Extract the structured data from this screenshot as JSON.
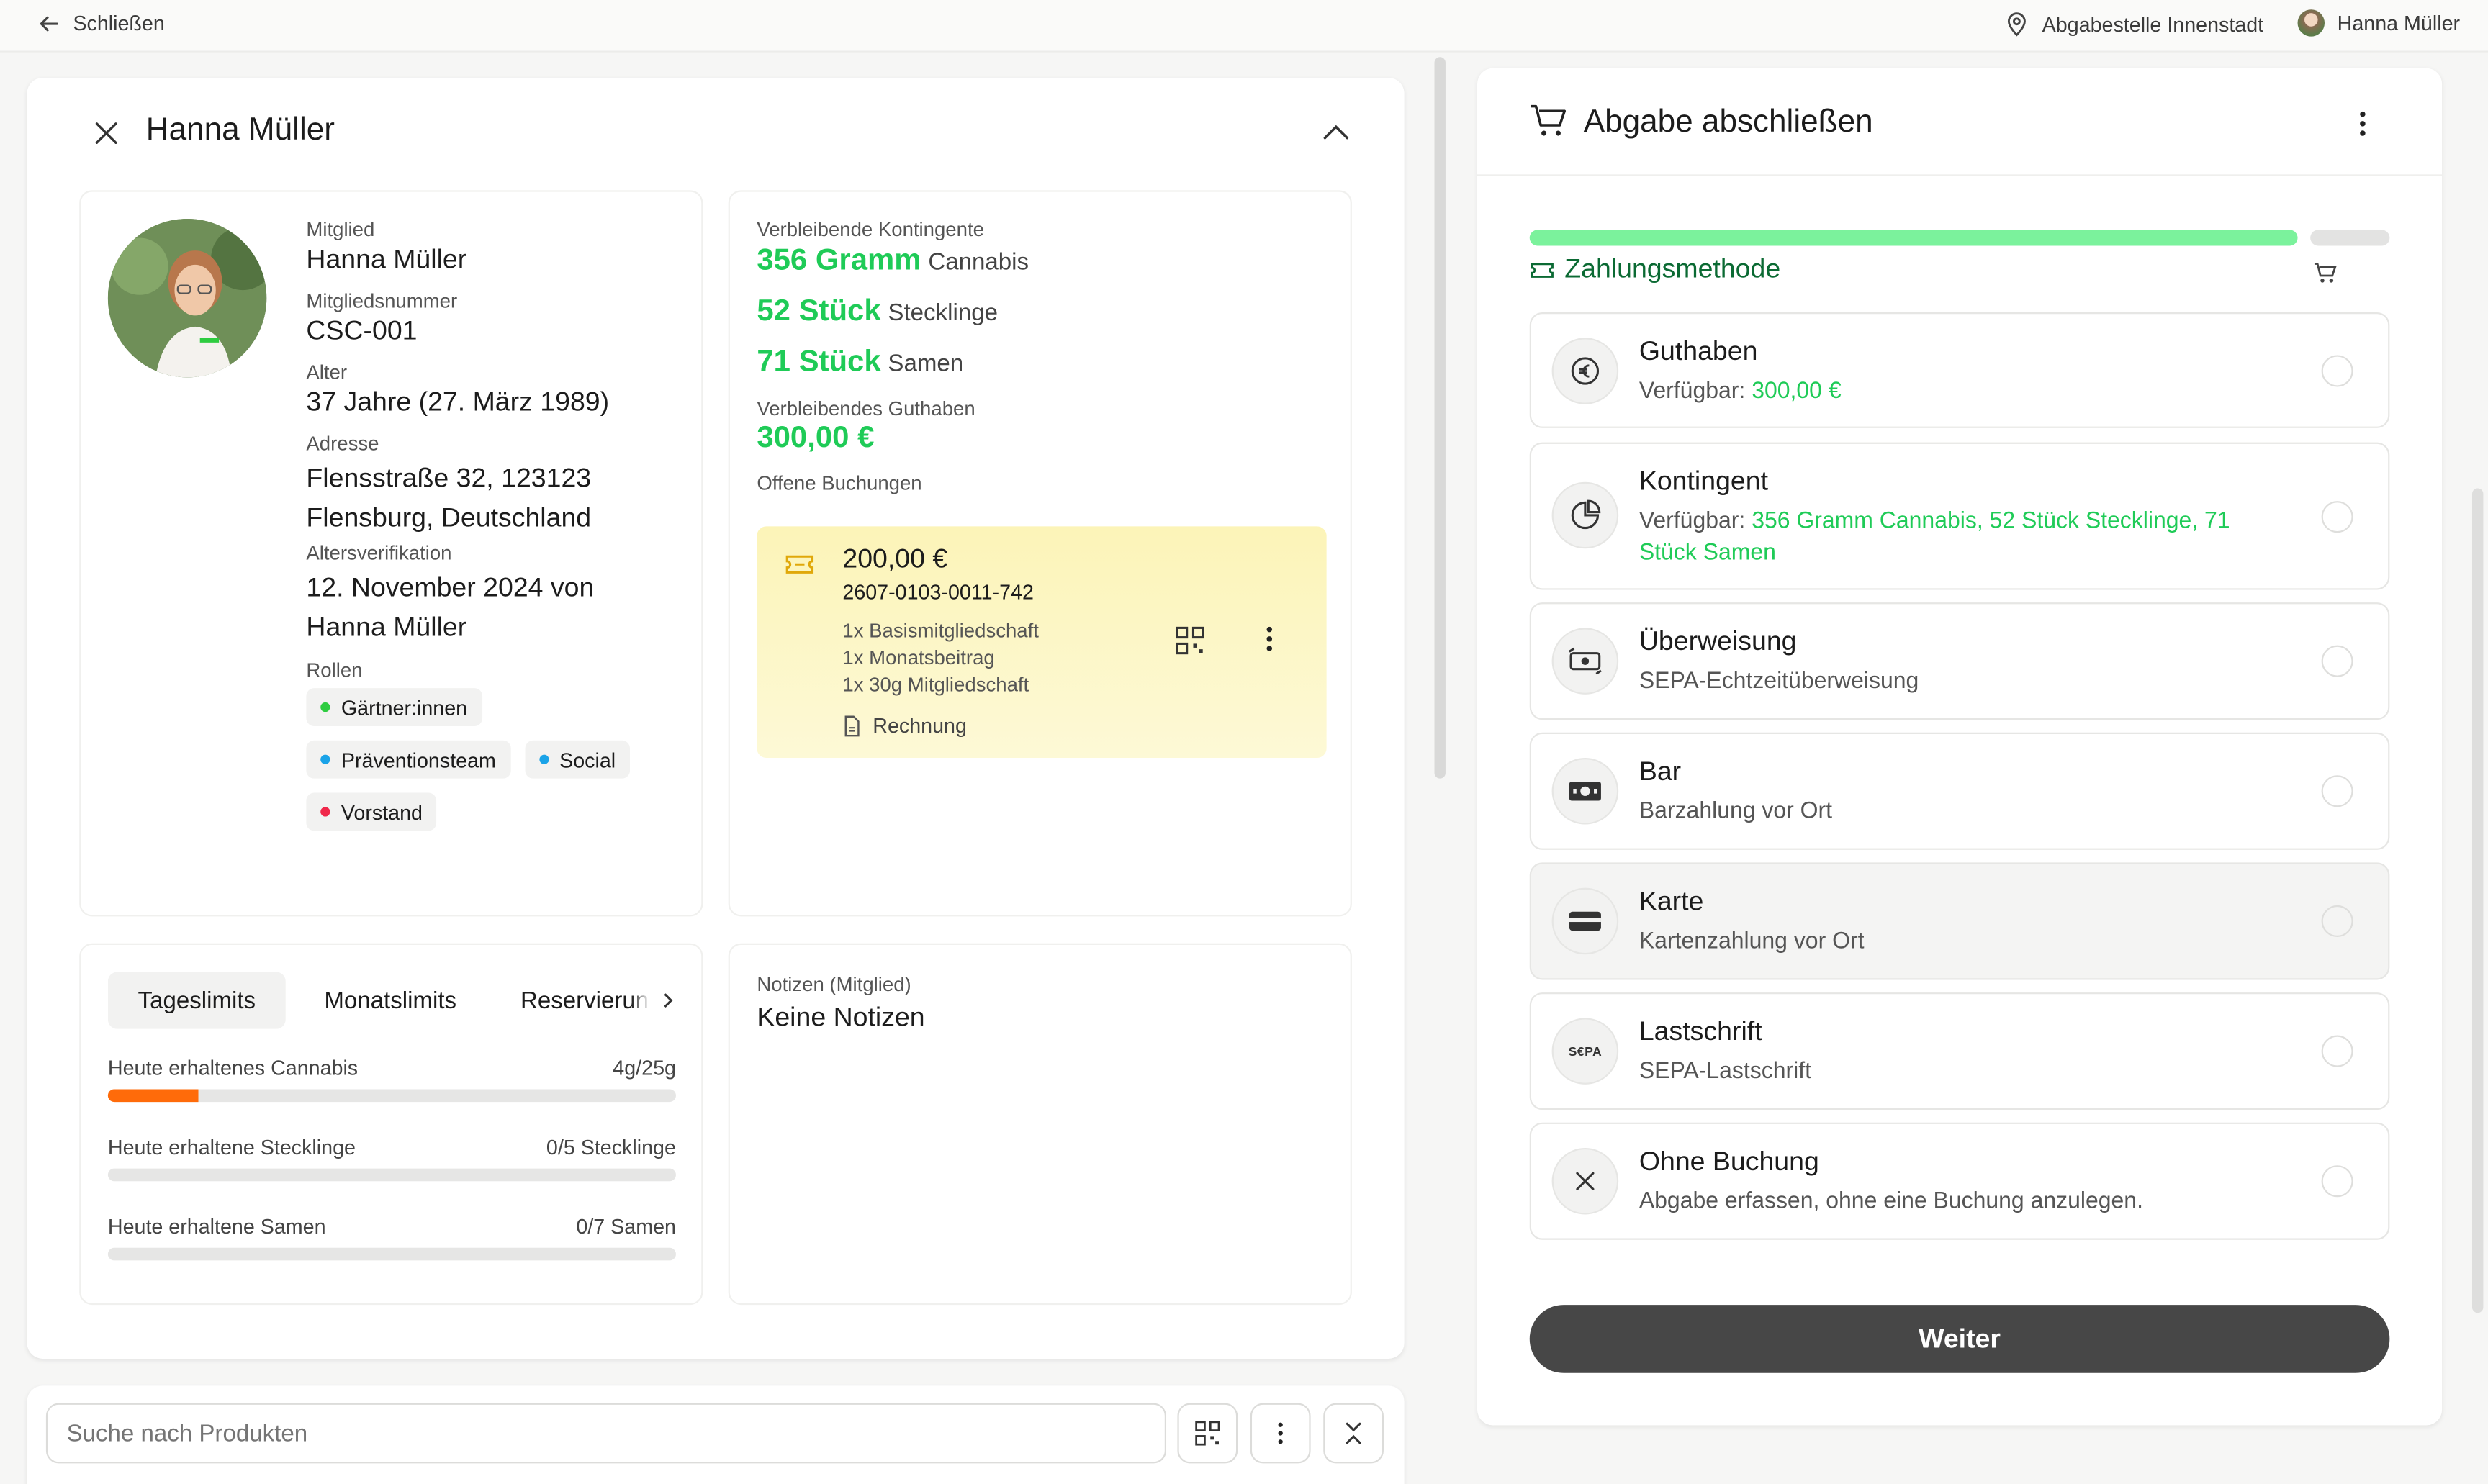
{
  "topbar": {
    "close_label": "Schließen",
    "location": "Abgabestelle Innenstadt",
    "user_name": "Hanna Müller"
  },
  "member_panel": {
    "title": "Hanna Müller",
    "profile": {
      "member_label": "Mitglied",
      "member_value": "Hanna Müller",
      "number_label": "Mitgliedsnummer",
      "number_value": "CSC-001",
      "age_label": "Alter",
      "age_value": "37 Jahre (27. März 1989)",
      "address_label": "Adresse",
      "address_line1": "Flensstraße 32, 123123",
      "address_line2": "Flensburg, Deutschland",
      "verification_label": "Altersverifikation",
      "verification_line1": "12. November 2024 von",
      "verification_line2": "Hanna Müller",
      "roles_label": "Rollen",
      "roles": [
        {
          "name": "Gärtner:innen",
          "color": "#2ecc40"
        },
        {
          "name": "Präventionsteam",
          "color": "#1aa3e8"
        },
        {
          "name": "Social",
          "color": "#1aa3e8"
        },
        {
          "name": "Vorstand",
          "color": "#f0284a"
        }
      ]
    },
    "quotas": {
      "label": "Verbleibende Kontingente",
      "items": [
        {
          "amount": "356 Gramm",
          "unit": "Cannabis"
        },
        {
          "amount": "52 Stück",
          "unit": "Stecklinge"
        },
        {
          "amount": "71 Stück",
          "unit": "Samen"
        }
      ],
      "balance_label": "Verbleibendes Guthaben",
      "balance_value": "300,00 €",
      "open_label": "Offene Buchungen",
      "booking": {
        "amount": "200,00 €",
        "number": "2607-0103-0011-742",
        "lines": [
          "1x Basismitgliedschaft",
          "1x Monatsbeitrag",
          "1x 30g Mitgliedschaft"
        ],
        "invoice_label": "Rechnung"
      }
    },
    "limits": {
      "tabs": [
        "Tageslimits",
        "Monatslimits",
        "Reservierungen"
      ],
      "active_tab": 0,
      "rows": [
        {
          "label": "Heute erhaltenes Cannabis",
          "value": "4g/25g",
          "fraction": 0.16
        },
        {
          "label": "Heute erhaltene Stecklinge",
          "value": "0/5 Stecklinge",
          "fraction": 0
        },
        {
          "label": "Heute erhaltene Samen",
          "value": "0/7 Samen",
          "fraction": 0
        }
      ]
    },
    "notes": {
      "label": "Notizen (Mitglied)",
      "value": "Keine Notizen"
    }
  },
  "search": {
    "placeholder": "Suche nach Produkten"
  },
  "checkout": {
    "title": "Abgabe abschließen",
    "step_label": "Zahlungsmethode",
    "progress": 0.9,
    "options": [
      {
        "title": "Guthaben",
        "sub_prefix": "Verfügbar: ",
        "sub_highlight": "300,00 €",
        "icon": "euro-icon"
      },
      {
        "title": "Kontingent",
        "sub_prefix": "Verfügbar: ",
        "sub_highlight_1": "356 Gramm Cannabis, 52 Stück Stecklinge, 71",
        "sub_highlight_2": "Stück Samen",
        "icon": "pie-chart-icon"
      },
      {
        "title": "Überweisung",
        "sub": "SEPA-Echtzeitüberweisung",
        "icon": "transfer-icon"
      },
      {
        "title": "Bar",
        "sub": "Barzahlung vor Ort",
        "icon": "cash-icon"
      },
      {
        "title": "Karte",
        "sub": "Kartenzahlung vor Ort",
        "icon": "card-icon"
      },
      {
        "title": "Lastschrift",
        "sub": "SEPA-Lastschrift",
        "icon": "sepa-icon",
        "icon_text": "S€PA"
      },
      {
        "title": "Ohne Buchung",
        "sub": "Abgabe erfassen, ohne eine Buchung anzulegen.",
        "icon": "close-icon"
      }
    ],
    "continue_label": "Weiter"
  },
  "colors": {
    "accent_green": "#1fcb57",
    "progress_green": "#7bf29c",
    "booking_yellow": "#fdf7c4",
    "cannabis_bar": "#ff6b0a",
    "button_dark": "#474747"
  }
}
